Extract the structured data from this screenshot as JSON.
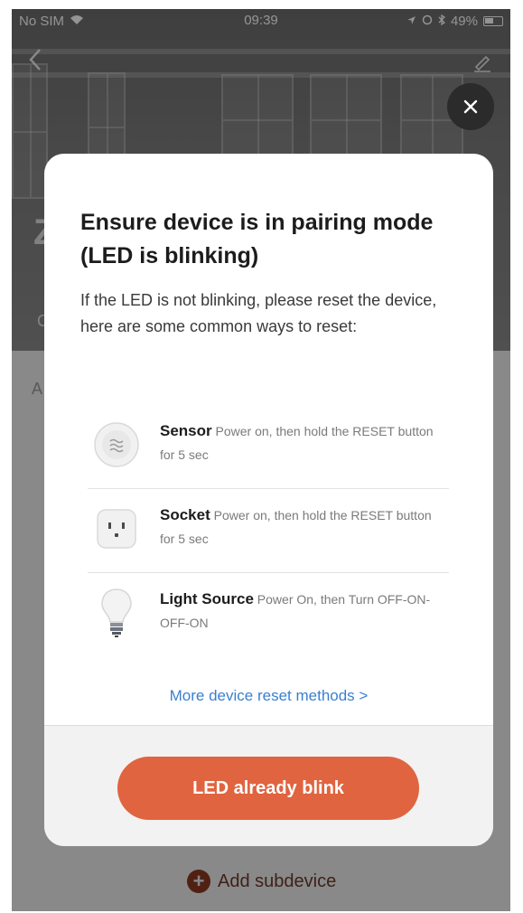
{
  "status_bar": {
    "carrier": "No SIM",
    "time": "09:39",
    "battery": "49%"
  },
  "background": {
    "title_partial": "Z",
    "subtitle_partial": "C",
    "section_partial": "A",
    "add_subdevice_label": "Add subdevice"
  },
  "modal": {
    "title": "Ensure device is in pairing mode (LED is blinking)",
    "description": "If the LED is not blinking, please reset the device, here are some common ways to reset:",
    "methods": [
      {
        "name": "Sensor",
        "detail": "Power on, then hold the RESET button for 5 sec",
        "icon": "sensor-icon"
      },
      {
        "name": "Socket",
        "detail": "Power on, then hold the RESET button for 5 sec",
        "icon": "socket-icon"
      },
      {
        "name": "Light Source",
        "detail": "Power On, then Turn OFF-ON-OFF-ON",
        "icon": "light-bulb-icon"
      }
    ],
    "more_link": "More device reset methods >",
    "primary_button": "LED already blink"
  },
  "colors": {
    "accent": "#e0643f",
    "link": "#3a7fd0",
    "scrim": "rgba(0,0,0,0.42)"
  }
}
